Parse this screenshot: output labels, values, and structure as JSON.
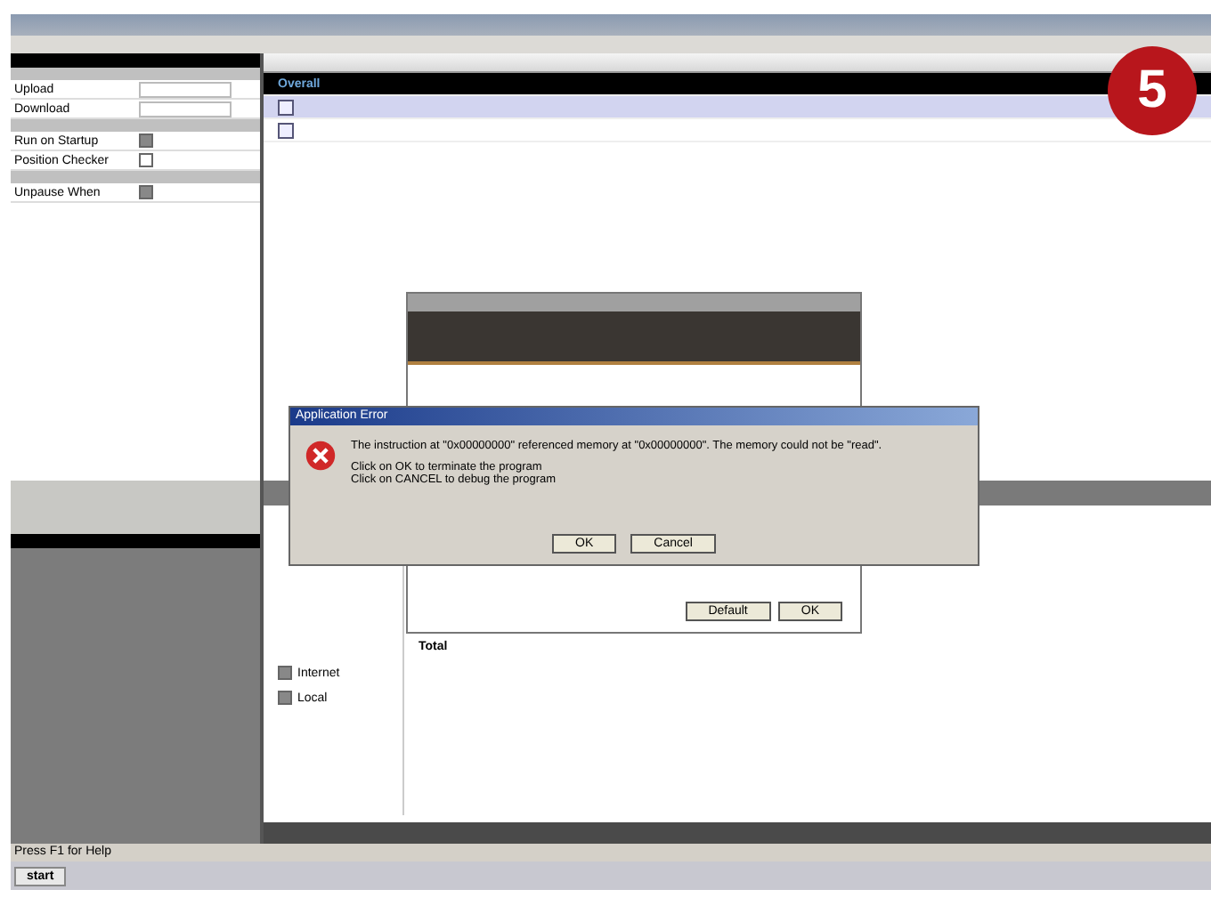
{
  "badge": "5",
  "settings": {
    "sections": [
      {
        "rows": [
          {
            "label": "Upload",
            "kind": "value"
          },
          {
            "label": "Download",
            "kind": "value"
          }
        ]
      },
      {
        "rows": [
          {
            "label": "Run on Startup",
            "kind": "checkbox",
            "checked": true
          },
          {
            "label": "Position Checker",
            "kind": "checkbox",
            "checked": false
          }
        ]
      },
      {
        "rows": [
          {
            "label": "Unpause When",
            "kind": "checkbox",
            "checked": true
          }
        ]
      }
    ]
  },
  "table": {
    "rows": [
      {
        "label": "Overall",
        "kind": "summary",
        "selected": false
      },
      {
        "kind": "item",
        "selected": true
      },
      {
        "kind": "item",
        "selected": false
      }
    ]
  },
  "wizard": {
    "buttons": [
      "Default",
      "OK"
    ]
  },
  "error_dialog": {
    "title": "Application Error",
    "message": "The instruction at \"0x00000000\" referenced memory at \"0x00000000\". The memory could not be \"read\".",
    "hints": [
      "Click on OK to terminate the program",
      "Click on CANCEL to debug the program"
    ],
    "buttons": [
      "OK",
      "Cancel"
    ]
  },
  "stats": {
    "options": [
      {
        "label": "Internet",
        "checked": true
      },
      {
        "label": "Local",
        "checked": true
      }
    ],
    "total_label": "Total"
  },
  "status_bar": "Press F1 for Help",
  "taskbar": {
    "start": "start"
  }
}
